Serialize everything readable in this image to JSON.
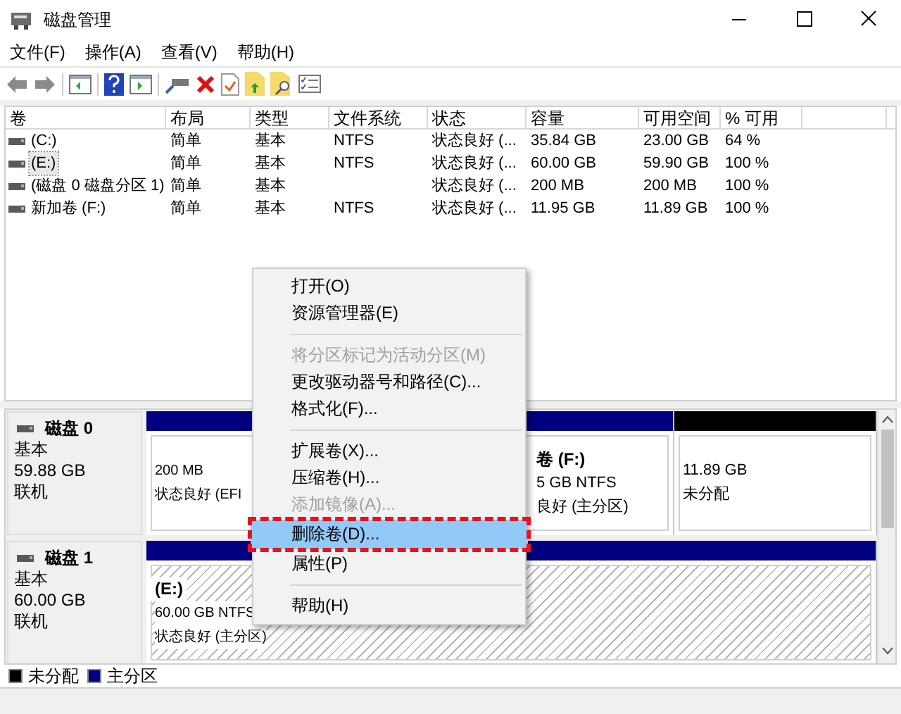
{
  "window": {
    "title": "磁盘管理"
  },
  "menu_bar": [
    {
      "label": "文件(F)"
    },
    {
      "label": "操作(A)"
    },
    {
      "label": "查看(V)"
    },
    {
      "label": "帮助(H)"
    }
  ],
  "volume_table": {
    "columns": [
      "卷",
      "布局",
      "类型",
      "文件系统",
      "状态",
      "容量",
      "可用空间",
      "% 可用"
    ],
    "rows": [
      {
        "selected": false,
        "cells": [
          "(C:)",
          "简单",
          "基本",
          "NTFS",
          "状态良好 (...",
          "35.84 GB",
          "23.00 GB",
          "64 %"
        ]
      },
      {
        "selected": true,
        "cells": [
          "(E:)",
          "简单",
          "基本",
          "NTFS",
          "状态良好 (...",
          "60.00 GB",
          "59.90 GB",
          "100 %"
        ]
      },
      {
        "selected": false,
        "cells": [
          "(磁盘 0 磁盘分区 1)",
          "简单",
          "基本",
          "",
          "状态良好 (...",
          "200 MB",
          "200 MB",
          "100 %"
        ]
      },
      {
        "selected": false,
        "cells": [
          "新加卷 (F:)",
          "简单",
          "基本",
          "NTFS",
          "状态良好 (...",
          "11.95 GB",
          "11.89 GB",
          "100 %"
        ]
      }
    ]
  },
  "disks": [
    {
      "name": "磁盘 0",
      "type": "基本",
      "size": "59.88 GB",
      "status": "联机",
      "partitions": [
        {
          "kind": "primary",
          "selected": false,
          "lines": [
            "200 MB",
            "状态良好 (EFI"
          ]
        },
        {
          "kind": "primary",
          "selected": false,
          "label": "卷 (F:)",
          "lines": [
            "5 GB NTFS",
            "良好 (主分区)"
          ]
        },
        {
          "kind": "unallocated",
          "selected": false,
          "lines": [
            "11.89 GB",
            "未分配"
          ]
        }
      ]
    },
    {
      "name": "磁盘 1",
      "type": "基本",
      "size": "60.00 GB",
      "status": "联机",
      "partitions": [
        {
          "kind": "primary",
          "selected": true,
          "label": "(E:)",
          "lines": [
            "60.00 GB NTFS",
            "状态良好 (主分区)"
          ]
        }
      ]
    }
  ],
  "legend": [
    {
      "label": "未分配",
      "color": "#000000"
    },
    {
      "label": "主分区",
      "color": "#000080"
    }
  ],
  "context_menu": [
    {
      "kind": "item",
      "label": "打开(O)",
      "disabled": false,
      "selected": false
    },
    {
      "kind": "item",
      "label": "资源管理器(E)",
      "disabled": false,
      "selected": false
    },
    {
      "kind": "separator"
    },
    {
      "kind": "item",
      "label": "将分区标记为活动分区(M)",
      "disabled": true,
      "selected": false
    },
    {
      "kind": "item",
      "label": "更改驱动器号和路径(C)...",
      "disabled": false,
      "selected": false
    },
    {
      "kind": "item",
      "label": "格式化(F)...",
      "disabled": false,
      "selected": false
    },
    {
      "kind": "separator"
    },
    {
      "kind": "item",
      "label": "扩展卷(X)...",
      "disabled": false,
      "selected": false
    },
    {
      "kind": "item",
      "label": "压缩卷(H)...",
      "disabled": false,
      "selected": false
    },
    {
      "kind": "item",
      "label": "添加镜像(A)...",
      "disabled": true,
      "selected": false
    },
    {
      "kind": "item",
      "label": "删除卷(D)...",
      "disabled": false,
      "selected": true
    },
    {
      "kind": "item",
      "label": "属性(P)",
      "disabled": false,
      "selected": false
    },
    {
      "kind": "separator"
    },
    {
      "kind": "item",
      "label": "帮助(H)",
      "disabled": false,
      "selected": false
    }
  ]
}
